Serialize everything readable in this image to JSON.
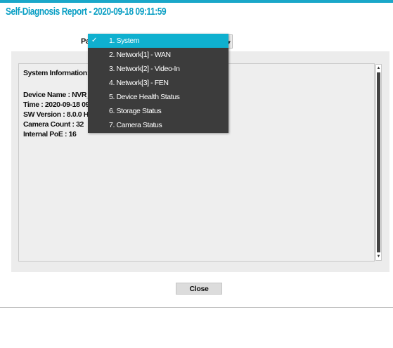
{
  "dialog": {
    "title": "Self-Diagnosis Report - 2020-09-18 09:11:59",
    "close_label": "Close"
  },
  "page_selector": {
    "label": "Page",
    "visible_label": "Pa"
  },
  "report": {
    "section_heading": "System Information:",
    "lines": [
      "Device Name : NVR_WAN_0",
      "Time : 2020-09-18 09:11:59",
      "SW Version : 8.0.0 HLA8001",
      "Camera Count : 32",
      "Internal PoE : 16"
    ]
  },
  "dropdown": {
    "selected_index": 0,
    "items": [
      "1. System",
      "2. Network[1] - WAN",
      "3. Network[2] - Video-In",
      "4. Network[3] - FEN",
      "5. Device Health Status",
      "6. Storage Status",
      "7. Camera Status"
    ]
  },
  "colors": {
    "accent": "#0a9fc4",
    "selected_item": "#0fb0cf",
    "menu_bg": "#3c3c3c"
  },
  "icons": [
    "check-icon",
    "chevron-down-icon",
    "scroll-up-icon",
    "scroll-down-icon"
  ]
}
